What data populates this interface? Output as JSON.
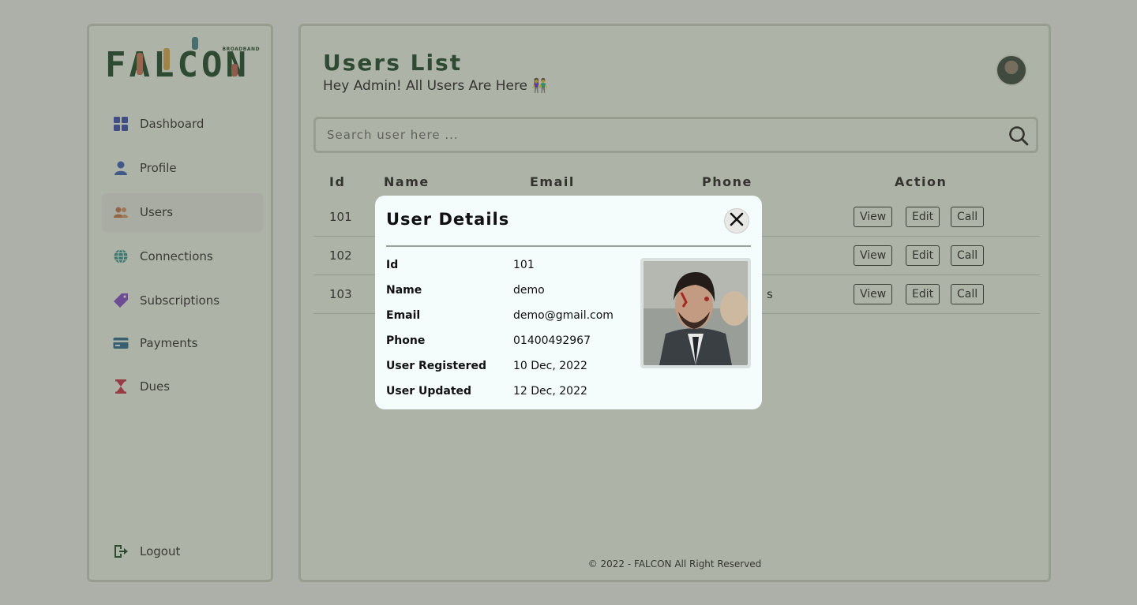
{
  "brand": {
    "logo_text": "FALCON",
    "logo_subtext": "BROADBAND"
  },
  "sidebar": {
    "items": [
      {
        "label": "Dashboard",
        "icon": "grid-icon"
      },
      {
        "label": "Profile",
        "icon": "person-icon"
      },
      {
        "label": "Users",
        "icon": "users-icon"
      },
      {
        "label": "Connections",
        "icon": "globe-icon"
      },
      {
        "label": "Subscriptions",
        "icon": "tag-icon"
      },
      {
        "label": "Payments",
        "icon": "credit-card-icon"
      },
      {
        "label": "Dues",
        "icon": "hourglass-icon"
      }
    ],
    "active": "Users",
    "logout_label": "Logout"
  },
  "header": {
    "title": "Users List",
    "subtitle": "Hey Admin! All Users Are Here 👫"
  },
  "search": {
    "placeholder": "Search user here ..."
  },
  "table": {
    "columns": [
      "Id",
      "Name",
      "Email",
      "Phone",
      "Action"
    ],
    "rows": [
      {
        "id": "101"
      },
      {
        "id": "102"
      },
      {
        "id": "103",
        "trail": "s"
      }
    ],
    "actions": [
      "View",
      "Edit",
      "Call"
    ]
  },
  "footer": {
    "text": "© 2022 - FALCON All Right Reserved"
  },
  "modal": {
    "title": "User Details",
    "fields": [
      {
        "label": "Id",
        "value": "101"
      },
      {
        "label": "Name",
        "value": "demo"
      },
      {
        "label": "Email",
        "value": "demo@gmail.com"
      },
      {
        "label": "Phone",
        "value": "01400492967"
      },
      {
        "label": "User Registered",
        "value": "10 Dec, 2022"
      },
      {
        "label": "User Updated",
        "value": "12 Dec, 2022"
      }
    ]
  },
  "colors": {
    "brand_green": "#0c3a1c",
    "grid_icon": "#2a3fb3",
    "person_icon": "#2c55b8",
    "users_icon": "#c26a3a",
    "globe_icon": "#2a8a8a",
    "tag_icon": "#7a3cc8",
    "card_icon": "#1d5f8a",
    "hourglass_icon": "#c8203a"
  }
}
